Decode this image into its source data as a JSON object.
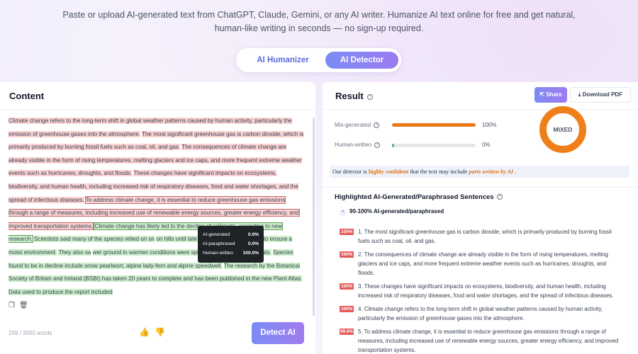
{
  "intro": {
    "line1": "Paste or upload AI-generated text from ChatGPT, Claude, Gemini, or any AI writer. Humanize AI text online for free and get natural,",
    "line2": "human-like writing in seconds — no sign-up required."
  },
  "tabs": [
    {
      "label": "AI Humanizer",
      "active": false
    },
    {
      "label": "AI Detector",
      "active": true
    }
  ],
  "content": {
    "title": "Content",
    "segments": [
      {
        "text": "Climate change refers to the long-term shift in global weather patterns caused by human activity, particularly the emission of greenhouse gases into the atmosphere.",
        "kind": "ai"
      },
      {
        "text": "The most significant greenhouse gas is carbon dioxide, which is primarily produced by burning fossil fuels such as coal, oil, and gas.",
        "kind": "ai"
      },
      {
        "text": "The consequences of climate change are already visible in the form of rising temperatures, melting glaciers and ice caps, and more frequent extreme weather events such as hurricanes, droughts, and floods.",
        "kind": "ai"
      },
      {
        "text": "These changes have significant impacts on ecosystems, biodiversity, and human health, including increased risk of respiratory diseases, food and water shortages, and the spread of infectious diseases.",
        "kind": "ai"
      },
      {
        "text": "To address climate change, it is essential to reduce greenhouse gas emissions through a range of measures, including increased use of renewable energy sources, greater energy efficiency, and improved transportation systems.",
        "kind": "ai-boxed"
      },
      {
        "text": "Climate change has likely led to the decline of so",
        "kind": "human-boxed"
      },
      {
        "text": "plants, according to new research.",
        "kind": "human-boxed"
      },
      {
        "text": "Scientists said many of the species relied on sn",
        "kind": "human"
      },
      {
        "text": "on hills until late spring and even summer to ensure a moist environment.",
        "kind": "human"
      },
      {
        "text": "They also sa",
        "kind": "human"
      },
      {
        "text": "wer ground in warmer conditions were spreading to mountain habitats.",
        "kind": "human"
      },
      {
        "text": "Species found to be in decline include snow pearlwort, alpine lady-fern and alpine speedwell.",
        "kind": "human"
      },
      {
        "text": "The research by the Botanical Society of Britain and Ireland (BSBI) has taken 20 years to complete and has been published in the new Plant Atlas.",
        "kind": "human"
      },
      {
        "text": "Data used to produce the report included",
        "kind": "human"
      }
    ],
    "tooltip": [
      {
        "label": "AI-generated",
        "value": "0.0%"
      },
      {
        "label": "AI-paraphrased",
        "value": "0.0%"
      },
      {
        "label": "Human-written",
        "value": "100.0%"
      }
    ],
    "word_count": "259 / 3000 words",
    "detect_label": "Detect AI"
  },
  "result": {
    "title": "Result",
    "share_label": "Share",
    "pdf_label": "Download PDF",
    "metrics": [
      {
        "label": "Mix-generated",
        "value": "100%",
        "fraction": 1.0,
        "color": "#ea7a1a"
      },
      {
        "label": "Human-written",
        "value": "0%",
        "fraction": 0.0,
        "color": "#3ec46d"
      }
    ],
    "donut_label": "MIXED",
    "verdict": {
      "pre": "Our detector is",
      "strong": "highly confident",
      "mid": "that the text may include",
      "em": "parts written by AI",
      "post": "."
    },
    "highlighted_title": "Highlighted AI-Generated/Paraphrased Sentences",
    "group_label": "90-100% AI-generated/paraphrased",
    "sentences": [
      {
        "badge": "100%",
        "text": "1. The most significant greenhouse gas is carbon dioxide, which is primarily produced by burning fossil fuels such as coal, oil, and gas."
      },
      {
        "badge": "100%",
        "text": "2. The consequences of climate change are already visible in the form of rising temperatures, melting glaciers and ice caps, and more frequent extreme weather events such as hurricanes, droughts, and floods."
      },
      {
        "badge": "100%",
        "text": "3. These changes have significant impacts on ecosystems, biodiversity, and human health, including increased risk of respiratory diseases, food and water shortages, and the spread of infectious diseases."
      },
      {
        "badge": "100%",
        "text": "4. Climate change refers to the long-term shift in global weather patterns caused by human activity, particularly the emission of greenhouse gases into the atmosphere."
      },
      {
        "badge": "99.9%",
        "text": "5. To address climate change, it is essential to reduce greenhouse gas emissions through a range of measures, including increased use of renewable energy sources, greater energy efficiency, and improved transportation systems."
      }
    ]
  },
  "colors": {
    "accent": "#7a8cf4",
    "ai_highlight": "#fbd3d3",
    "human_highlight": "#cdeec9",
    "warning": "#ea7a1a",
    "badge": "#e45b5b"
  }
}
